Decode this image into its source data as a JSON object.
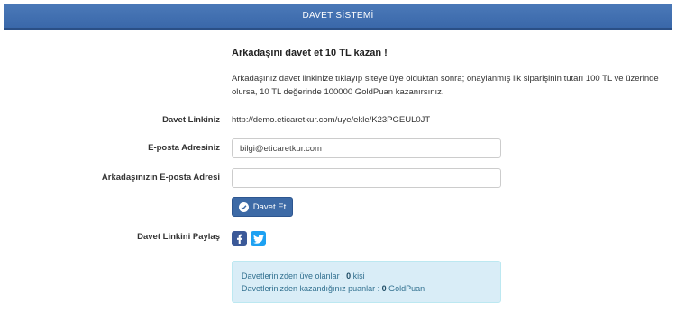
{
  "header": {
    "title": "DAVET SİSTEMİ"
  },
  "intro": {
    "heading": "Arkadaşını davet et 10 TL kazan !",
    "description": "Arkadaşınız davet linkinize tıklayıp siteye üye olduktan sonra; onaylanmış ilk siparişinin tutarı 100 TL ve üzerinde olursa, 10 TL değerinde 100000 GoldPuan kazanırsınız."
  },
  "form": {
    "link_label": "Davet Linkiniz",
    "link_value": "http://demo.eticaretkur.com/uye/ekle/K23PGEUL0JT",
    "email_label": "E-posta Adresiniz",
    "email_value": "bilgi@eticaretkur.com",
    "friend_email_label": "Arkadaşınızın E-posta Adresi",
    "friend_email_value": "",
    "submit_label": "Davet Et",
    "share_label": "Davet Linkini Paylaş"
  },
  "stats": {
    "members_prefix": "Davetlerinizden üye olanlar :",
    "members_count": "0",
    "members_suffix": "kişi",
    "points_prefix": "Davetlerinizden kazandığınız puanlar :",
    "points_count": "0",
    "points_suffix": "GoldPuan"
  },
  "colors": {
    "header": "#3a68aa",
    "button": "#3d6aa6",
    "facebook": "#3b5998",
    "twitter": "#1da1f2",
    "info_bg": "#d9edf7"
  },
  "icons": [
    "check-circle-icon",
    "facebook-icon",
    "twitter-icon"
  ]
}
